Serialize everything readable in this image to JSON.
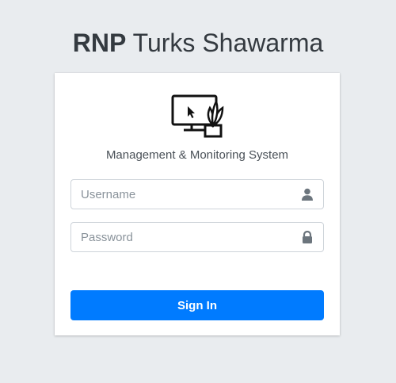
{
  "brand": {
    "bold": "RNP",
    "light": "Turks Shawarma"
  },
  "card": {
    "logo_icon": "computer-plant-icon",
    "subtitle": "Management & Monitoring System"
  },
  "form": {
    "username": {
      "placeholder": "Username",
      "value": "",
      "icon": "user-icon"
    },
    "password": {
      "placeholder": "Password",
      "value": "",
      "icon": "lock-icon"
    },
    "submit_label": "Sign In"
  },
  "colors": {
    "background": "#e9ecef",
    "primary": "#007bff",
    "icon": "#6c757d"
  }
}
